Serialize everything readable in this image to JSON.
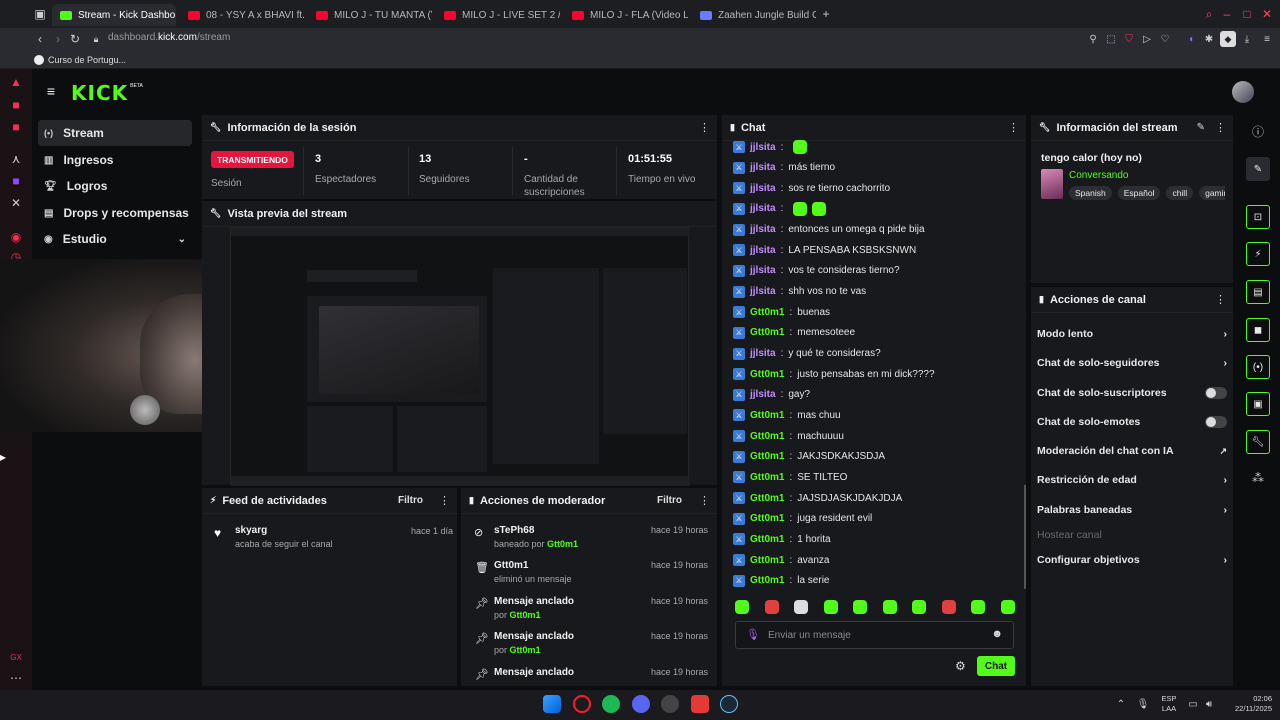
{
  "browser": {
    "tabs": [
      {
        "label": "Stream - Kick Dashbo",
        "active": true,
        "color": "#53fc18"
      },
      {
        "label": "08 - YSY A x BHAVI ft. M",
        "color": "#ff0033"
      },
      {
        "label": "MILO J - TU MANTA (Vid",
        "color": "#ff0033"
      },
      {
        "label": "MILO J - LIVE SET 2 // M",
        "color": "#ff0033"
      },
      {
        "label": "MILO J - FLA (Video Lyric",
        "color": "#ff0033"
      },
      {
        "label": "Zaahen Jungle Build Guid",
        "color": "#6b7bff"
      }
    ],
    "url_prefix": "dashboard.",
    "url_domain": "kick.com",
    "url_path": "/stream",
    "bookmark": "Curso de Portugu..."
  },
  "brand": {
    "logo": "KICK",
    "beta": "BETA",
    "accent": "#53fc18"
  },
  "sidebar": {
    "items": [
      {
        "label": "Stream"
      },
      {
        "label": "Ingresos"
      },
      {
        "label": "Logros"
      },
      {
        "label": "Drops y recompensas"
      },
      {
        "label": "Estudio"
      }
    ]
  },
  "session": {
    "title": "Información de la sesión",
    "status": "TRANSMITIENDO",
    "status_label": "Sesión",
    "viewers": "3",
    "viewers_label": "Espectadores",
    "followers": "13",
    "followers_label": "Seguidores",
    "subs": "-",
    "subs_label": "Cantidad de suscripciones",
    "uptime": "01:51:55",
    "uptime_label": "Tiempo en vivo"
  },
  "preview": {
    "title": "Vista previa del stream"
  },
  "activity": {
    "title": "Feed de actividades",
    "filter": "Filtro",
    "items": [
      {
        "user": "skyarg",
        "text": "acaba de seguir el canal",
        "time": "hace 1 día"
      }
    ]
  },
  "mod": {
    "title": "Acciones de moderador",
    "filter": "Filtro",
    "items": [
      {
        "title": "sTePh68",
        "sub_prefix": "baneado por ",
        "sub_user": "Gtt0m1",
        "time": "hace 19 horas"
      },
      {
        "title": "Gtt0m1",
        "sub_prefix": "eliminó un mensaje",
        "sub_user": "",
        "time": "hace 19 horas"
      },
      {
        "title": "Mensaje anclado",
        "sub_prefix": "por ",
        "sub_user": "Gtt0m1",
        "time": "hace 19 horas"
      },
      {
        "title": "Mensaje anclado",
        "sub_prefix": "por ",
        "sub_user": "Gtt0m1",
        "time": "hace 19 horas"
      },
      {
        "title": "Mensaje anclado",
        "sub_prefix": "",
        "sub_user": "",
        "time": "hace 19 horas"
      }
    ]
  },
  "chat": {
    "title": "Chat",
    "messages": [
      {
        "user": "jjlsita",
        "text": "",
        "emotes": 1
      },
      {
        "user": "jjlsita",
        "text": "más tierno"
      },
      {
        "user": "jjlsita",
        "text": "sos re tierno cachorrito"
      },
      {
        "user": "jjlsita",
        "text": "",
        "emotes": 2
      },
      {
        "user": "jjlsita",
        "text": "entonces un omega q pide bija"
      },
      {
        "user": "jjlsita",
        "text": "LA PENSABA KSBSKSNWN"
      },
      {
        "user": "jjlsita",
        "text": "vos te consideras tierno?"
      },
      {
        "user": "jjlsita",
        "text": "shh vos no te vas"
      },
      {
        "user": "Gtt0m1",
        "text": "buenas",
        "mod": true
      },
      {
        "user": "Gtt0m1",
        "text": "memesoteee",
        "mod": true
      },
      {
        "user": "jjlsita",
        "text": "y qué te consideras?"
      },
      {
        "user": "Gtt0m1",
        "text": "justo pensabas en mi dick????",
        "mod": true
      },
      {
        "user": "jjlsita",
        "text": "gay?"
      },
      {
        "user": "Gtt0m1",
        "text": "mas chuu",
        "mod": true
      },
      {
        "user": "Gtt0m1",
        "text": "machuuuu",
        "mod": true
      },
      {
        "user": "Gtt0m1",
        "text": "JAKJSDKAKJSDJA",
        "mod": true
      },
      {
        "user": "Gtt0m1",
        "text": "SE TILTEO",
        "mod": true
      },
      {
        "user": "Gtt0m1",
        "text": "JAJSDJASKJDAKJDJA",
        "mod": true
      },
      {
        "user": "Gtt0m1",
        "text": "juga resident evil",
        "mod": true
      },
      {
        "user": "Gtt0m1",
        "text": "1 horita",
        "mod": true
      },
      {
        "user": "Gtt0m1",
        "text": "avanza",
        "mod": true
      },
      {
        "user": "Gtt0m1",
        "text": "la serie",
        "mod": true
      }
    ],
    "placeholder": "Enviar un mensaje",
    "send": "Chat"
  },
  "stream_info": {
    "title": "Información del stream",
    "stream_title": "tengo calor (hoy no)",
    "category": "Conversando",
    "tags": [
      "Spanish",
      "Español",
      "chill",
      "gaming"
    ]
  },
  "channel_actions": {
    "title": "Acciones de canal",
    "items": [
      {
        "label": "Modo lento",
        "kind": "arrow"
      },
      {
        "label": "Chat de solo-seguidores",
        "kind": "arrow"
      },
      {
        "label": "Chat de solo-suscriptores",
        "kind": "toggle"
      },
      {
        "label": "Chat de solo-emotes",
        "kind": "toggle"
      },
      {
        "label": "Moderación del chat con IA",
        "kind": "link"
      },
      {
        "label": "Restricción de edad",
        "kind": "arrow"
      },
      {
        "label": "Palabras baneadas",
        "kind": "arrow"
      },
      {
        "label": "Hostear canal",
        "kind": "disabled"
      },
      {
        "label": "Configurar objetivos",
        "kind": "arrow"
      }
    ]
  },
  "taskbar": {
    "lang": "ESP",
    "layout": "LAA",
    "time": "02:06",
    "date": "22/11/2025"
  }
}
